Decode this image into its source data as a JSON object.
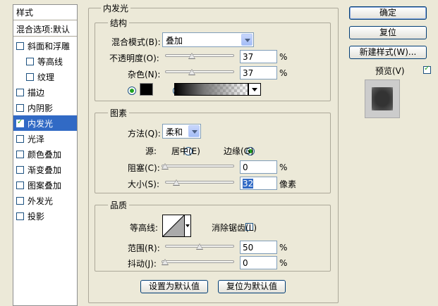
{
  "sidebar": {
    "header": "样式",
    "items": [
      {
        "label": "混合选项:默认",
        "checkbox": false,
        "checked": false,
        "indent": false,
        "selected": false
      },
      {
        "label": "斜面和浮雕",
        "checkbox": true,
        "checked": false,
        "indent": false,
        "selected": false
      },
      {
        "label": "等高线",
        "checkbox": true,
        "checked": false,
        "indent": true,
        "selected": false
      },
      {
        "label": "纹理",
        "checkbox": true,
        "checked": false,
        "indent": true,
        "selected": false
      },
      {
        "label": "描边",
        "checkbox": true,
        "checked": false,
        "indent": false,
        "selected": false
      },
      {
        "label": "内阴影",
        "checkbox": true,
        "checked": false,
        "indent": false,
        "selected": false
      },
      {
        "label": "内发光",
        "checkbox": true,
        "checked": true,
        "indent": false,
        "selected": true
      },
      {
        "label": "光泽",
        "checkbox": true,
        "checked": false,
        "indent": false,
        "selected": false
      },
      {
        "label": "颜色叠加",
        "checkbox": true,
        "checked": false,
        "indent": false,
        "selected": false
      },
      {
        "label": "渐变叠加",
        "checkbox": true,
        "checked": false,
        "indent": false,
        "selected": false
      },
      {
        "label": "图案叠加",
        "checkbox": true,
        "checked": false,
        "indent": false,
        "selected": false
      },
      {
        "label": "外发光",
        "checkbox": true,
        "checked": false,
        "indent": false,
        "selected": false
      },
      {
        "label": "投影",
        "checkbox": true,
        "checked": false,
        "indent": false,
        "selected": false
      }
    ]
  },
  "panel": {
    "title": "内发光"
  },
  "structure": {
    "title": "结构",
    "blend_label": "混合模式(B):",
    "blend_value": "叠加",
    "opacity_label": "不透明度(O):",
    "opacity_value": "37",
    "opacity_unit": "%",
    "opacity_level": 0.37,
    "noise_label": "杂色(N):",
    "noise_value": "37",
    "noise_unit": "%",
    "noise_level": 0.37,
    "solid_color_selected": true,
    "color_hex": "#000000"
  },
  "elements": {
    "title": "图素",
    "method_label": "方法(Q):",
    "method_value": "柔和",
    "source_label": "源:",
    "source_center": "居中(E)",
    "source_edge": "边缘(G)",
    "source_selected": "edge",
    "choke_label": "阻塞(C):",
    "choke_value": "0",
    "choke_unit": "%",
    "choke_level": 0,
    "size_label": "大小(S):",
    "size_value": "32",
    "size_unit": "像素",
    "size_level": 0.13
  },
  "quality": {
    "title": "品质",
    "contour_label": "等高线:",
    "antialias_label": "消除锯齿(L)",
    "antialias_checked": false,
    "range_label": "范围(R):",
    "range_value": "50",
    "range_unit": "%",
    "range_level": 0.5,
    "jitter_label": "抖动(J):",
    "jitter_value": "0",
    "jitter_unit": "%",
    "jitter_level": 0
  },
  "bottom_buttons": {
    "set_default": "设置为默认值",
    "reset_default": "复位为默认值"
  },
  "right_buttons": {
    "ok": "确定",
    "reset": "复位",
    "new_style": "新建样式(W)...",
    "preview_label": "预览(V)",
    "preview_checked": true
  }
}
